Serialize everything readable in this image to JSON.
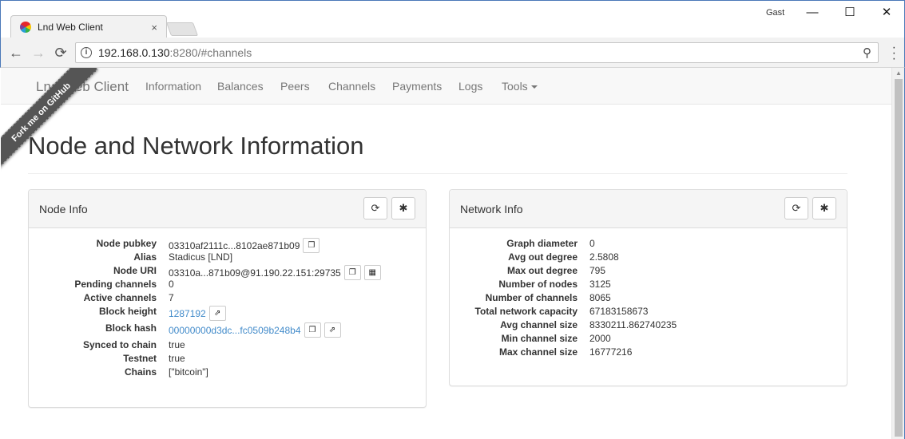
{
  "browser": {
    "tab_title": "Lnd Web Client",
    "tab_close": "×",
    "user": "Gast",
    "url_host": "192.168.0.130",
    "url_rest": ":8280/#channels",
    "minimize": "—",
    "maximize": "☐",
    "close": "✕"
  },
  "navbar": {
    "brand": "Lnd Web Client",
    "items": [
      "Information",
      "Balances",
      "Peers",
      "Channels",
      "Payments",
      "Logs",
      "Tools"
    ]
  },
  "ribbon": "Fork me on GitHub",
  "page_title": "Node and Network Information",
  "node_info": {
    "title": "Node Info",
    "rows": [
      {
        "key": "Node pubkey",
        "value": "03310af2111c...8102ae871b09"
      },
      {
        "key": "Alias",
        "value": "Stadicus [LND]"
      },
      {
        "key": "Node URI",
        "value": "03310a...871b09@91.190.22.151:29735"
      },
      {
        "key": "Pending channels",
        "value": "0"
      },
      {
        "key": "Active channels",
        "value": "7"
      },
      {
        "key": "Block height",
        "value": "1287192"
      },
      {
        "key": "Block hash",
        "value": "00000000d3dc...fc0509b248b4"
      },
      {
        "key": "Synced to chain",
        "value": "true"
      },
      {
        "key": "Testnet",
        "value": "true"
      },
      {
        "key": "Chains",
        "value": "[\"bitcoin\"]"
      }
    ]
  },
  "network_info": {
    "title": "Network Info",
    "rows": [
      {
        "key": "Graph diameter",
        "value": "0"
      },
      {
        "key": "Avg out degree",
        "value": "2.5808"
      },
      {
        "key": "Max out degree",
        "value": "795"
      },
      {
        "key": "Number of nodes",
        "value": "3125"
      },
      {
        "key": "Number of channels",
        "value": "8065"
      },
      {
        "key": "Total network capacity",
        "value": "67183158673"
      },
      {
        "key": "Avg channel size",
        "value": "8330211.862740235"
      },
      {
        "key": "Min channel size",
        "value": "2000"
      },
      {
        "key": "Max channel size",
        "value": "16777216"
      }
    ]
  },
  "icons": {
    "refresh": "⟳",
    "settings": "✱",
    "copy": "❐",
    "qr": "▦",
    "open": "⇗"
  },
  "colors": {
    "link": "#428bca",
    "ribbon": "#555555"
  }
}
